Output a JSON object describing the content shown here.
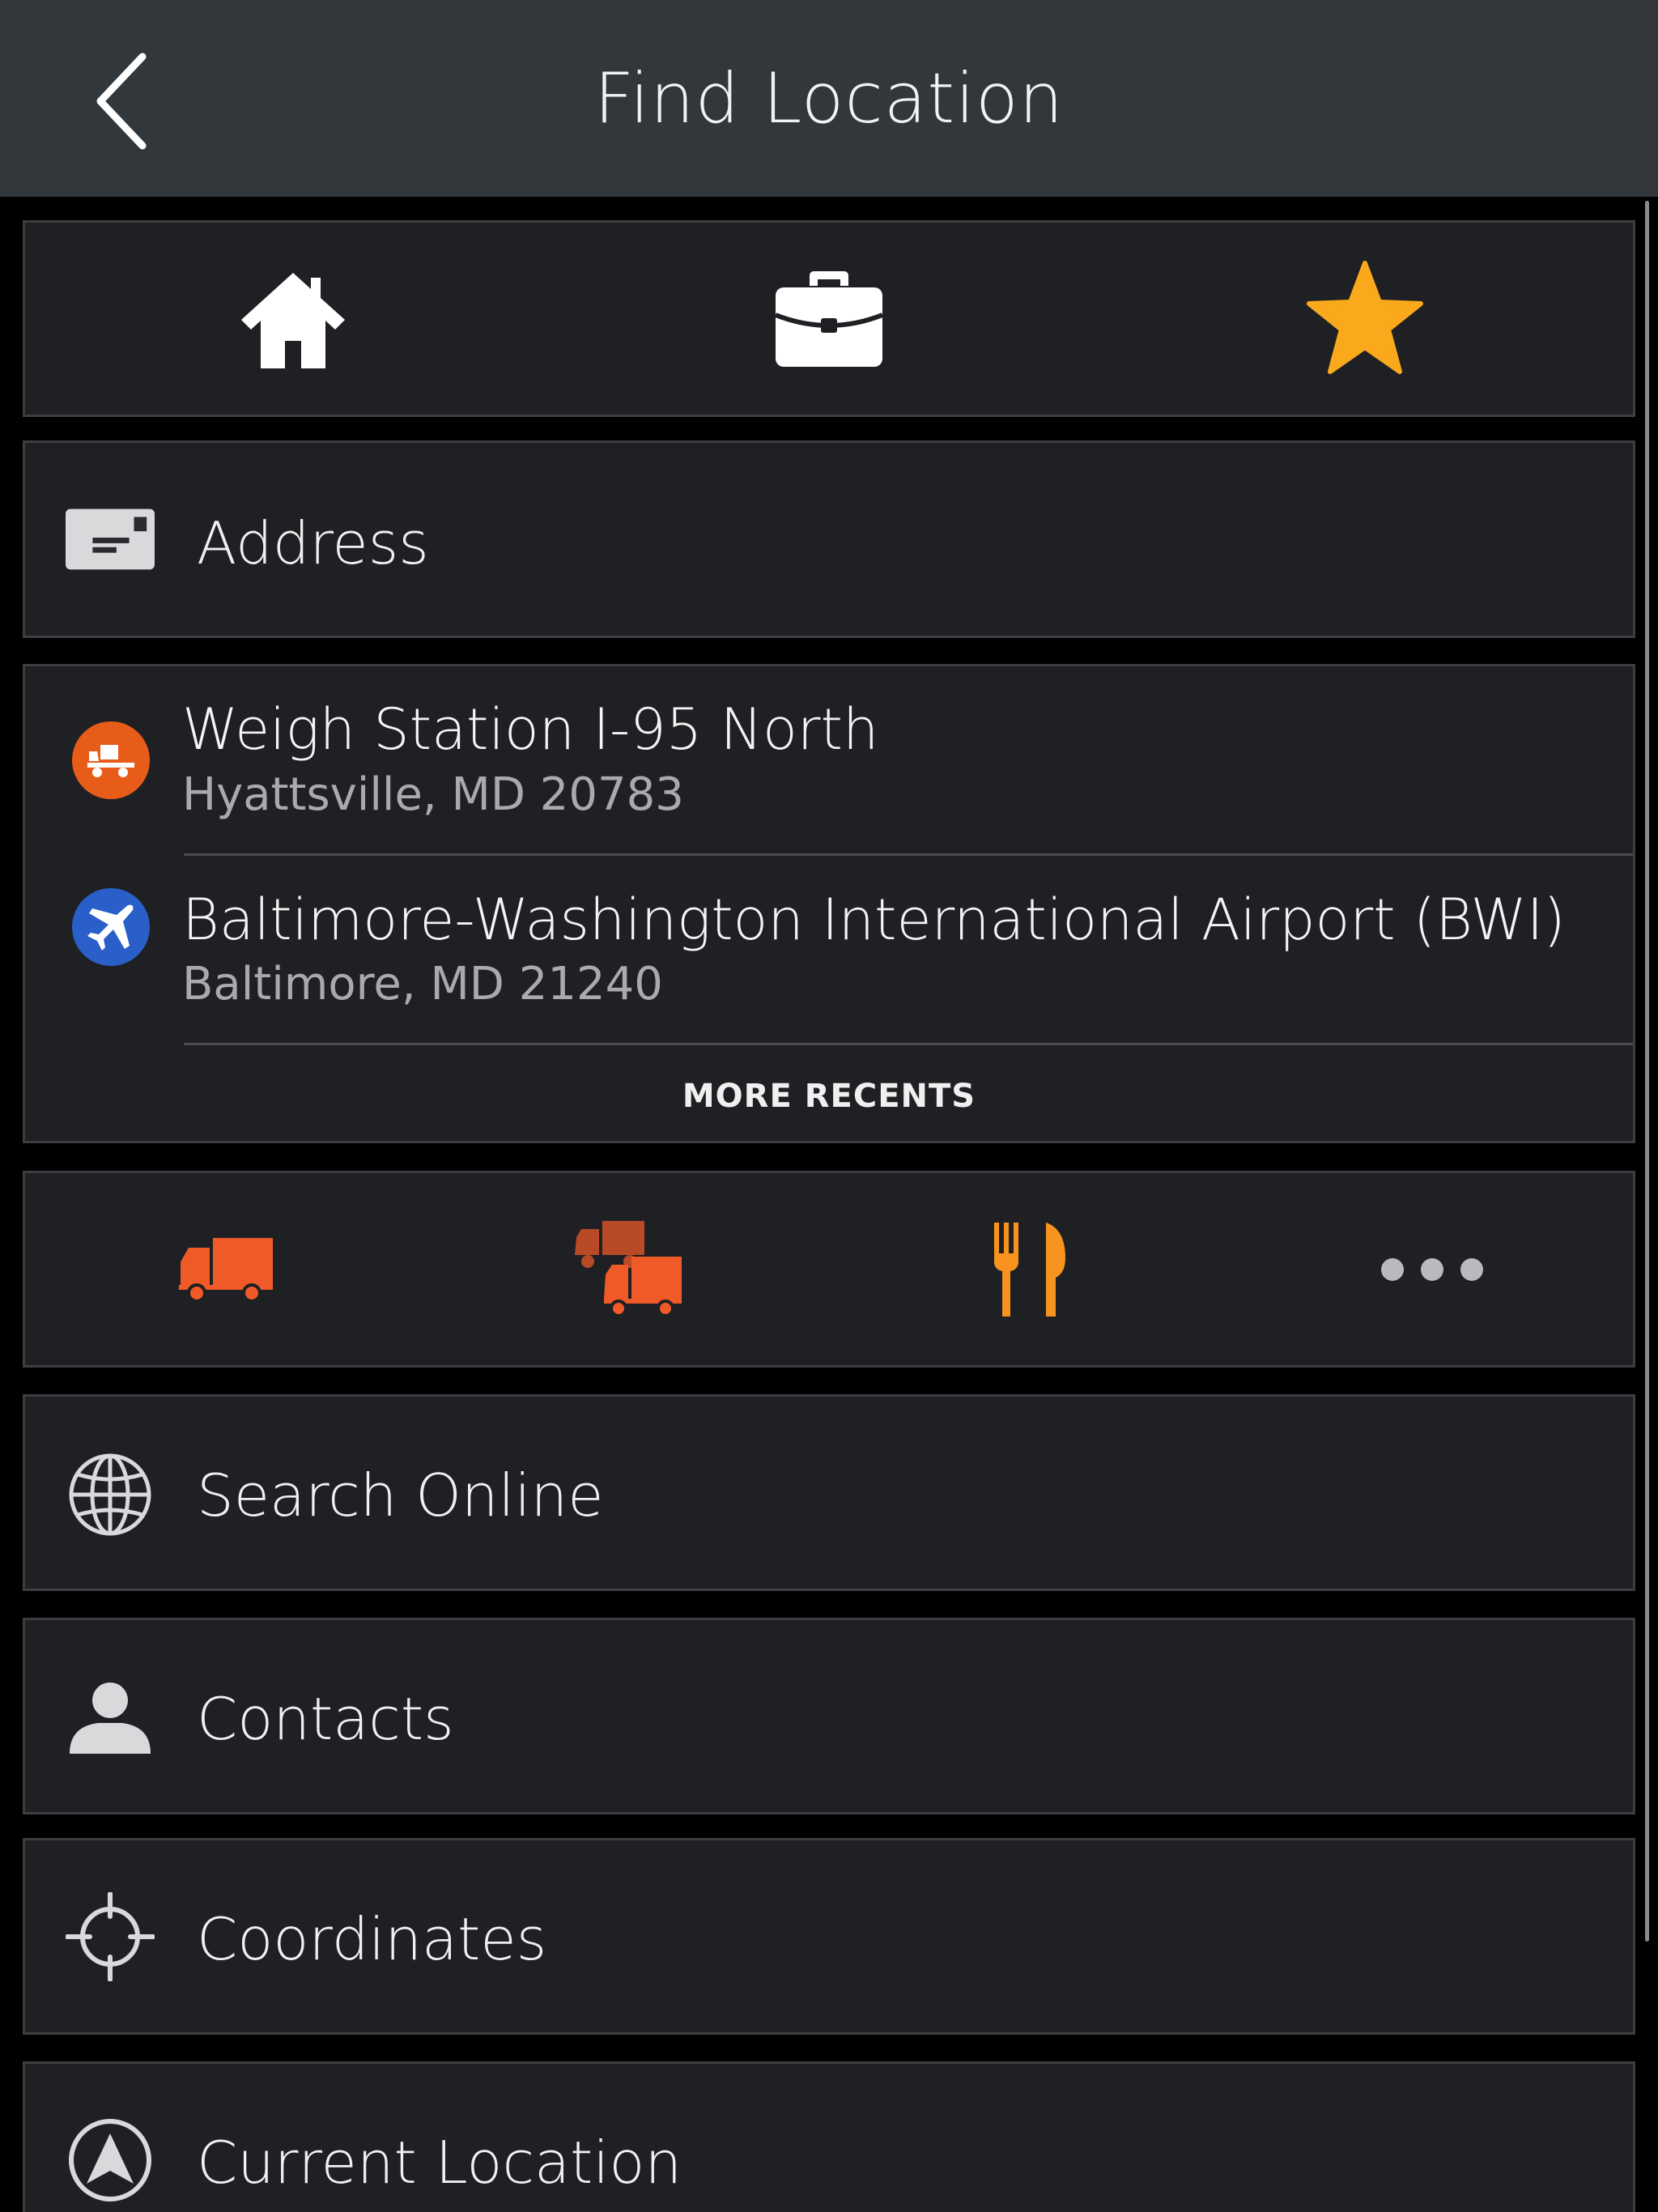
{
  "header": {
    "title": "Find Location",
    "back_icon": "back-chevron-icon"
  },
  "quick_access": [
    {
      "name": "home-icon",
      "color": "#ffffff"
    },
    {
      "name": "briefcase-icon",
      "color": "#ffffff"
    },
    {
      "name": "star-icon",
      "color": "#f9a91b"
    }
  ],
  "address": {
    "label": "Address",
    "icon": "address-card-icon"
  },
  "recents": {
    "items": [
      {
        "name": "Weigh Station I-95 North",
        "address": "Hyattsville, MD 20783",
        "icon": "weigh-station-icon",
        "icon_color": "#e85c1a"
      },
      {
        "name": "Baltimore-Washington International Airport (BWI)",
        "address": "Baltimore, MD 21240",
        "icon": "airport-icon",
        "icon_color": "#2a5fc9"
      }
    ],
    "more_label": "MORE RECENTS"
  },
  "categories": [
    {
      "name": "truck-icon",
      "color": "#ef5a28"
    },
    {
      "name": "truck-stops-icon",
      "color": "#ef5a28"
    },
    {
      "name": "food-icon",
      "color": "#f7931e"
    },
    {
      "name": "more-icon",
      "color": "#b9babd"
    }
  ],
  "menu": {
    "search_online": "Search Online",
    "contacts": "Contacts",
    "coordinates": "Coordinates",
    "current_location": "Current Location"
  }
}
